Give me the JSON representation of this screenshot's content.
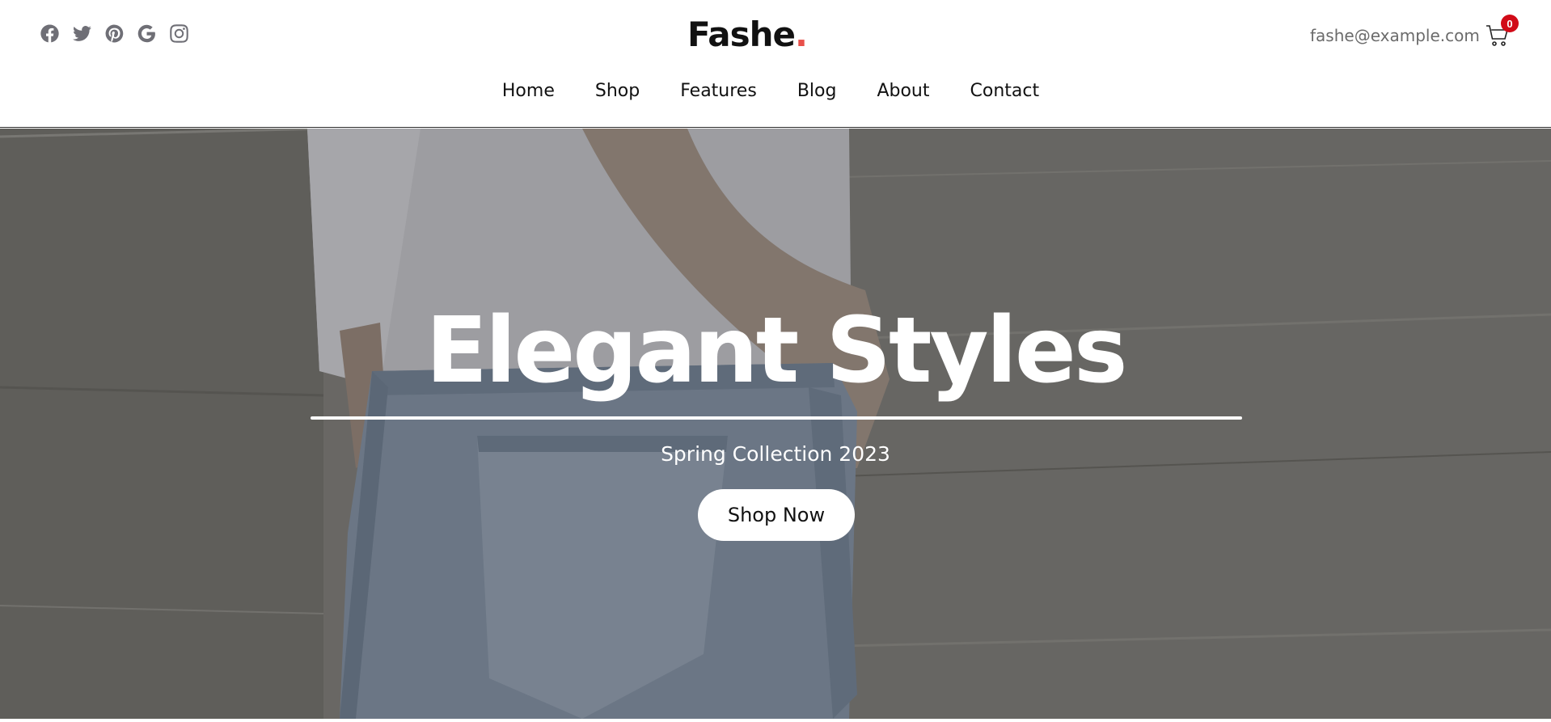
{
  "header": {
    "social_icons": [
      "facebook-icon",
      "twitter-icon",
      "pinterest-icon",
      "google-icon",
      "instagram-icon"
    ],
    "logo": {
      "text": "Fashe",
      "dot": ".",
      "dot_color": "#e8504a"
    },
    "email": "fashe@example.com",
    "cart": {
      "icon": "cart-icon",
      "count": "0",
      "badge_color": "#d10a17"
    }
  },
  "nav": {
    "items": [
      {
        "label": "Home"
      },
      {
        "label": "Shop"
      },
      {
        "label": "Features"
      },
      {
        "label": "Blog"
      },
      {
        "label": "About"
      },
      {
        "label": "Contact"
      }
    ]
  },
  "hero": {
    "title": "Elegant Styles",
    "subtitle": "Spring Collection 2023",
    "button_label": "Shop Now"
  }
}
